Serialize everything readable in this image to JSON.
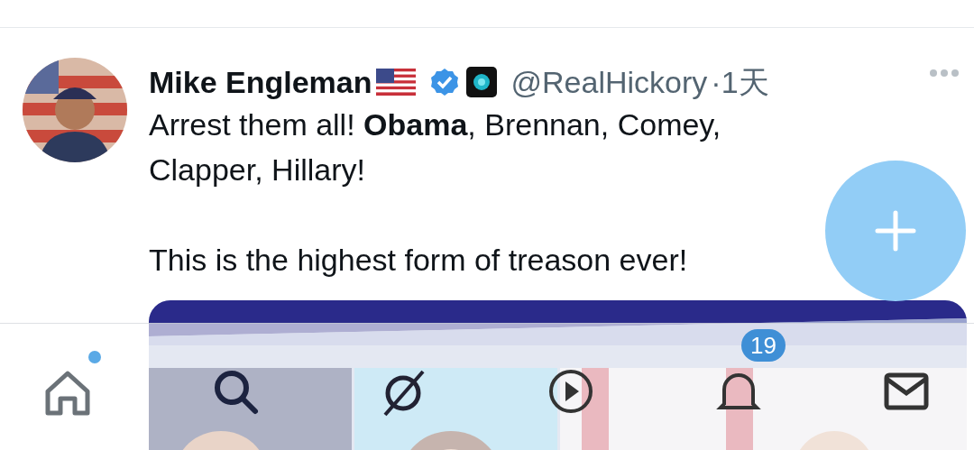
{
  "tweet": {
    "author": {
      "name": "Mike Engleman",
      "verified": true,
      "handle": "@RealHickory",
      "separator": "·",
      "time": "1天"
    },
    "paragraphs": [
      "Arrest them all! **Obama**, Brennan, Comey, Clapper, Hillary!",
      "This is the highest form of treason ever!"
    ]
  },
  "nav": [
    {
      "kind": "home",
      "unread": true
    },
    {
      "kind": "search",
      "unread": false
    },
    {
      "kind": "grok",
      "unread": false
    },
    {
      "kind": "video",
      "unread": false
    },
    {
      "kind": "notifications",
      "unread": false,
      "badge": "19"
    },
    {
      "kind": "messages",
      "unread": false
    }
  ]
}
